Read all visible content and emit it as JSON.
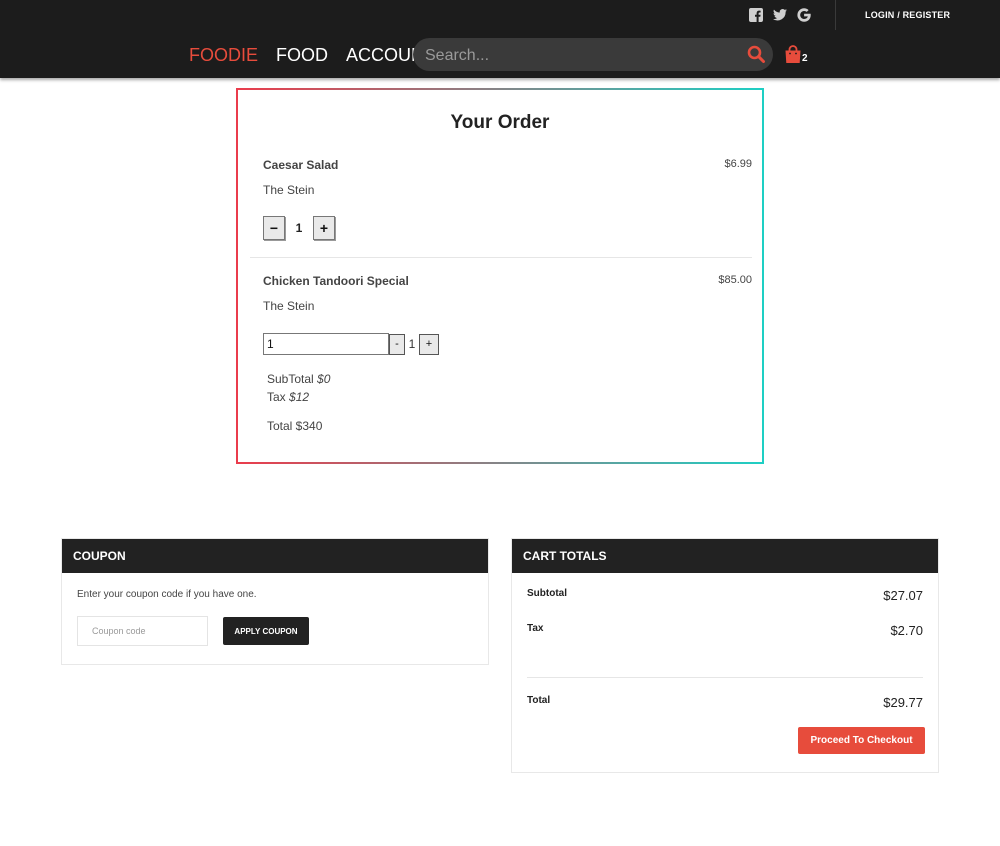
{
  "header": {
    "login_label": "LOGIN / REGISTER",
    "social": [
      "facebook-icon",
      "twitter-icon",
      "google-icon"
    ],
    "nav": {
      "brand": "FOODIE",
      "food": "FOOD",
      "account": "ACCOUNT"
    },
    "search_placeholder": "Search...",
    "cart_count": "2",
    "accent_color": "#e74c3c"
  },
  "order": {
    "title": "Your Order",
    "items": [
      {
        "name": "Caesar Salad",
        "restaurant": "The Stein",
        "price": "$6.99",
        "minus": "−",
        "qty": "1",
        "plus": "+"
      },
      {
        "name": "Chicken Tandoori Special",
        "restaurant": "The Stein",
        "price": "$85.00",
        "qty_input": "1",
        "minus": "-",
        "qty": "1",
        "plus": "+"
      }
    ],
    "subtotal_label": "SubTotal",
    "subtotal_value": "$0",
    "tax_label": "Tax",
    "tax_value": "$12",
    "total_text": "Total $340"
  },
  "coupon": {
    "heading": "COUPON",
    "hint": "Enter your coupon code if you have one.",
    "placeholder": "Coupon code",
    "apply_label": "APPLY COUPON"
  },
  "cart_totals": {
    "heading": "CART TOTALS",
    "subtotal_label": "Subtotal",
    "subtotal_value": "$27.07",
    "tax_label": "Tax",
    "tax_value": "$2.70",
    "total_label": "Total",
    "total_value": "$29.77",
    "checkout_label": "Proceed To Checkout"
  }
}
